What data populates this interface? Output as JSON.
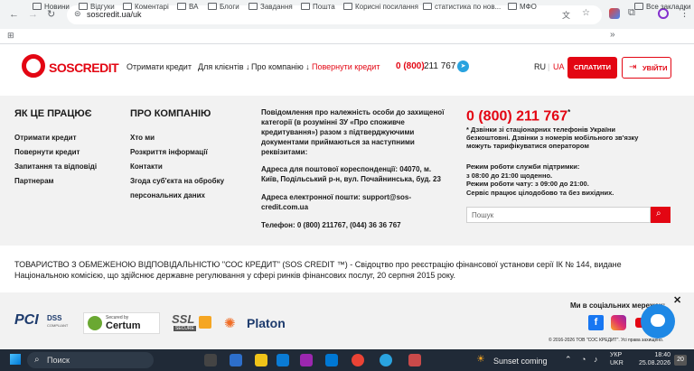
{
  "browser": {
    "url": "soscredit.ua/uk",
    "bookmarks": [
      "Новини",
      "Відгуки",
      "Коментарі",
      "ВА",
      "Блоги",
      "Завдання",
      "Пошта",
      "Корисні посилання",
      "статистика по нов...",
      "МФО"
    ],
    "all_bookmarks": "Все закладки"
  },
  "header": {
    "logo_text": "SOSCREDIT",
    "nav": [
      "Отримати кредит",
      "Для клієнтів ↓",
      "Про компанію ↓",
      "Повернути кредит"
    ],
    "phone_prefix": "0 (800)",
    "phone_number": "211 767",
    "lang_ru": "RU",
    "lang_sep": "|",
    "lang_ua": "UA",
    "pay_button": "СПЛАТИТИ",
    "login_button": "УВІЙТИ"
  },
  "footer": {
    "how_title": "ЯК ЦЕ ПРАЦЮЄ",
    "how_links": [
      "Отримати кредит",
      "Повернути кредит",
      "Запитання та відповіді",
      "Партнерам"
    ],
    "about_title": "ПРО КОМПАНІЮ",
    "about_links": [
      "Хто ми",
      "Розкриття інформації",
      "Контакти",
      "Згода суб'єкта на обробку",
      "персональних даних"
    ],
    "notice": {
      "line1": "Повідомлення про належність особи до захищеної",
      "line2": "категорії (в розумінні ЗУ «Про споживче",
      "line3": "кредитування») разом з підтверджуючими",
      "line4": "документами приймаються за наступними",
      "line5": "реквізитами:",
      "addr1": "Адреса для поштової кореспонденції: 04070, м.",
      "addr2": "Київ, Подільський р-н, вул. Почайнинська, буд. 23",
      "email1": "Адреса електронної пошти: support@sos-",
      "email2": "credit.com.ua",
      "tel": "Телефон: 0 (800) 211767, (044) 36 36 767"
    },
    "contact": {
      "phone": "0 (800) 211 767",
      "asterisk": "*",
      "note1": "* Дзвінки зі стаціонарних телефонів України",
      "note2": "безкоштовні.  Дзвінки з номерів мобільного зв'язку",
      "note3": "можуть тарифікуватися оператором",
      "hours1": "Режим роботи служби підтримки:",
      "hours2": "з 08:00 до 21:00 щоденно.",
      "hours3": "Режим роботи чату: з 09:00 до 21:00.",
      "hours4": "Сервіс працює цілодобово та без вихідних.",
      "search_placeholder": "Пошук"
    },
    "legal1": "ТОВАРИСТВО З ОБМЕЖЕНОЮ ВІДПОВІДАЛЬНІСТЮ \"СОС КРЕДИТ\" (SOS CREDIT ™) - Свідоцтво про реєстрацію фінансової установи серії ІК № 144, видане",
    "legal2": "Національною комісією, що здійснює державне регулювання у сфері ринків фінансових послуг, 20 серпня 2015 року.",
    "badges": {
      "pci": "PCI",
      "pci_dss": "DSS",
      "pci_small": "COMPLIANT",
      "certum_top": "Secured by",
      "certum": "Certum",
      "ssl": "SSL",
      "ssl_small": "SECURE",
      "platon": "Platon"
    },
    "social_title": "Ми в соціальних мережах:",
    "copyright": "© 2016-2026 ТОВ \"СОС КРЕДИТ\". Усі права захищено."
  },
  "taskbar": {
    "search": "Поиск",
    "weather": "Sunset coming",
    "lang1": "УКР",
    "lang2": "UKR",
    "time": "18:40",
    "date": "25.08.2026",
    "notif": "20"
  },
  "colors": {
    "brand_red": "#e30613",
    "dark": "#1a1a1a",
    "footer_bg": "#f2f2f2"
  }
}
